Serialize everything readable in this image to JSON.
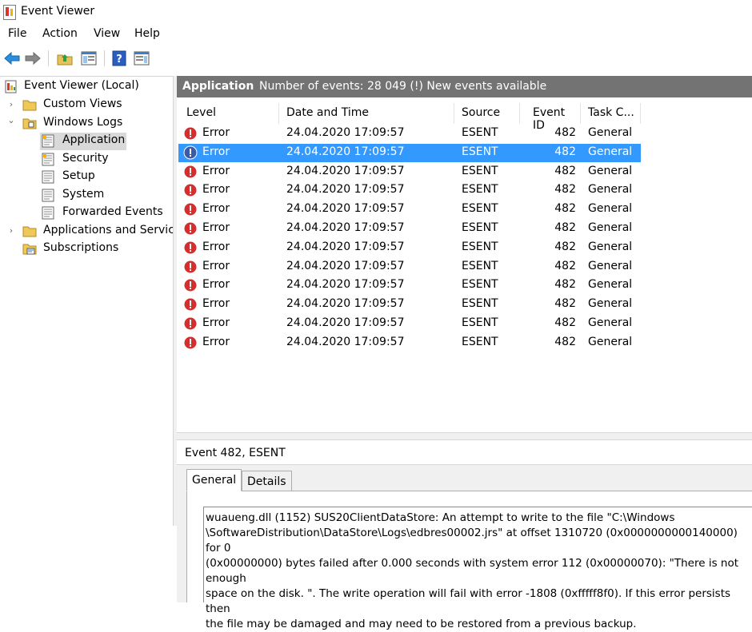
{
  "window": {
    "title": "Event Viewer"
  },
  "menu": [
    "File",
    "Action",
    "View",
    "Help"
  ],
  "tree": [
    {
      "label": "Event Viewer (Local)",
      "icon": "event-viewer-icon",
      "expander": ""
    },
    {
      "label": "Custom Views",
      "icon": "folder-icon",
      "expander": "›"
    },
    {
      "label": "Windows Logs",
      "icon": "folder-icon",
      "expander": "⌄"
    },
    {
      "label": "Application",
      "icon": "log-icon",
      "expander": "",
      "selected": true
    },
    {
      "label": "Security",
      "icon": "log-icon",
      "expander": ""
    },
    {
      "label": "Setup",
      "icon": "log-icon",
      "expander": ""
    },
    {
      "label": "System",
      "icon": "log-icon",
      "expander": ""
    },
    {
      "label": "Forwarded Events",
      "icon": "log-icon",
      "expander": ""
    },
    {
      "label": "Applications and Services Logs",
      "icon": "folder-icon",
      "expander": "›"
    },
    {
      "label": "Subscriptions",
      "icon": "subscriptions-icon",
      "expander": ""
    }
  ],
  "header": {
    "title": "Application",
    "status": "Number of events: 28 049 (!) New events available"
  },
  "columns": [
    "Level",
    "Date and Time",
    "Source",
    "Event ID",
    "Task C..."
  ],
  "events": [
    {
      "level": "Error",
      "datetime": "24.04.2020 17:09:57",
      "source": "ESENT",
      "event_id": "482",
      "task": "General"
    },
    {
      "level": "Error",
      "datetime": "24.04.2020 17:09:57",
      "source": "ESENT",
      "event_id": "482",
      "task": "General",
      "selected": true
    },
    {
      "level": "Error",
      "datetime": "24.04.2020 17:09:57",
      "source": "ESENT",
      "event_id": "482",
      "task": "General"
    },
    {
      "level": "Error",
      "datetime": "24.04.2020 17:09:57",
      "source": "ESENT",
      "event_id": "482",
      "task": "General"
    },
    {
      "level": "Error",
      "datetime": "24.04.2020 17:09:57",
      "source": "ESENT",
      "event_id": "482",
      "task": "General"
    },
    {
      "level": "Error",
      "datetime": "24.04.2020 17:09:57",
      "source": "ESENT",
      "event_id": "482",
      "task": "General"
    },
    {
      "level": "Error",
      "datetime": "24.04.2020 17:09:57",
      "source": "ESENT",
      "event_id": "482",
      "task": "General"
    },
    {
      "level": "Error",
      "datetime": "24.04.2020 17:09:57",
      "source": "ESENT",
      "event_id": "482",
      "task": "General"
    },
    {
      "level": "Error",
      "datetime": "24.04.2020 17:09:57",
      "source": "ESENT",
      "event_id": "482",
      "task": "General"
    },
    {
      "level": "Error",
      "datetime": "24.04.2020 17:09:57",
      "source": "ESENT",
      "event_id": "482",
      "task": "General"
    },
    {
      "level": "Error",
      "datetime": "24.04.2020 17:09:57",
      "source": "ESENT",
      "event_id": "482",
      "task": "General"
    },
    {
      "level": "Error",
      "datetime": "24.04.2020 17:09:57",
      "source": "ESENT",
      "event_id": "482",
      "task": "General"
    }
  ],
  "detail": {
    "title": "Event 482, ESENT",
    "tabs": [
      "General",
      "Details"
    ],
    "active_tab": "General",
    "description": "wuaueng.dll (1152) SUS20ClientDataStore: An attempt to write to the file \"C:\\Windows\n\\SoftwareDistribution\\DataStore\\Logs\\edbres00002.jrs\" at offset 1310720 (0x0000000000140000) for 0\n(0x00000000) bytes failed after 0.000 seconds with system error 112 (0x00000070): \"There is not enough\nspace on the disk. \".  The write operation will fail with error -1808 (0xfffff8f0).  If this error persists then\nthe file may be damaged and may need to be restored from a previous backup."
  },
  "colors": {
    "selection": "#3399ff",
    "header_bg": "#737373",
    "error_red": "#d32f2f",
    "selected_error": "#3b5ba8"
  }
}
